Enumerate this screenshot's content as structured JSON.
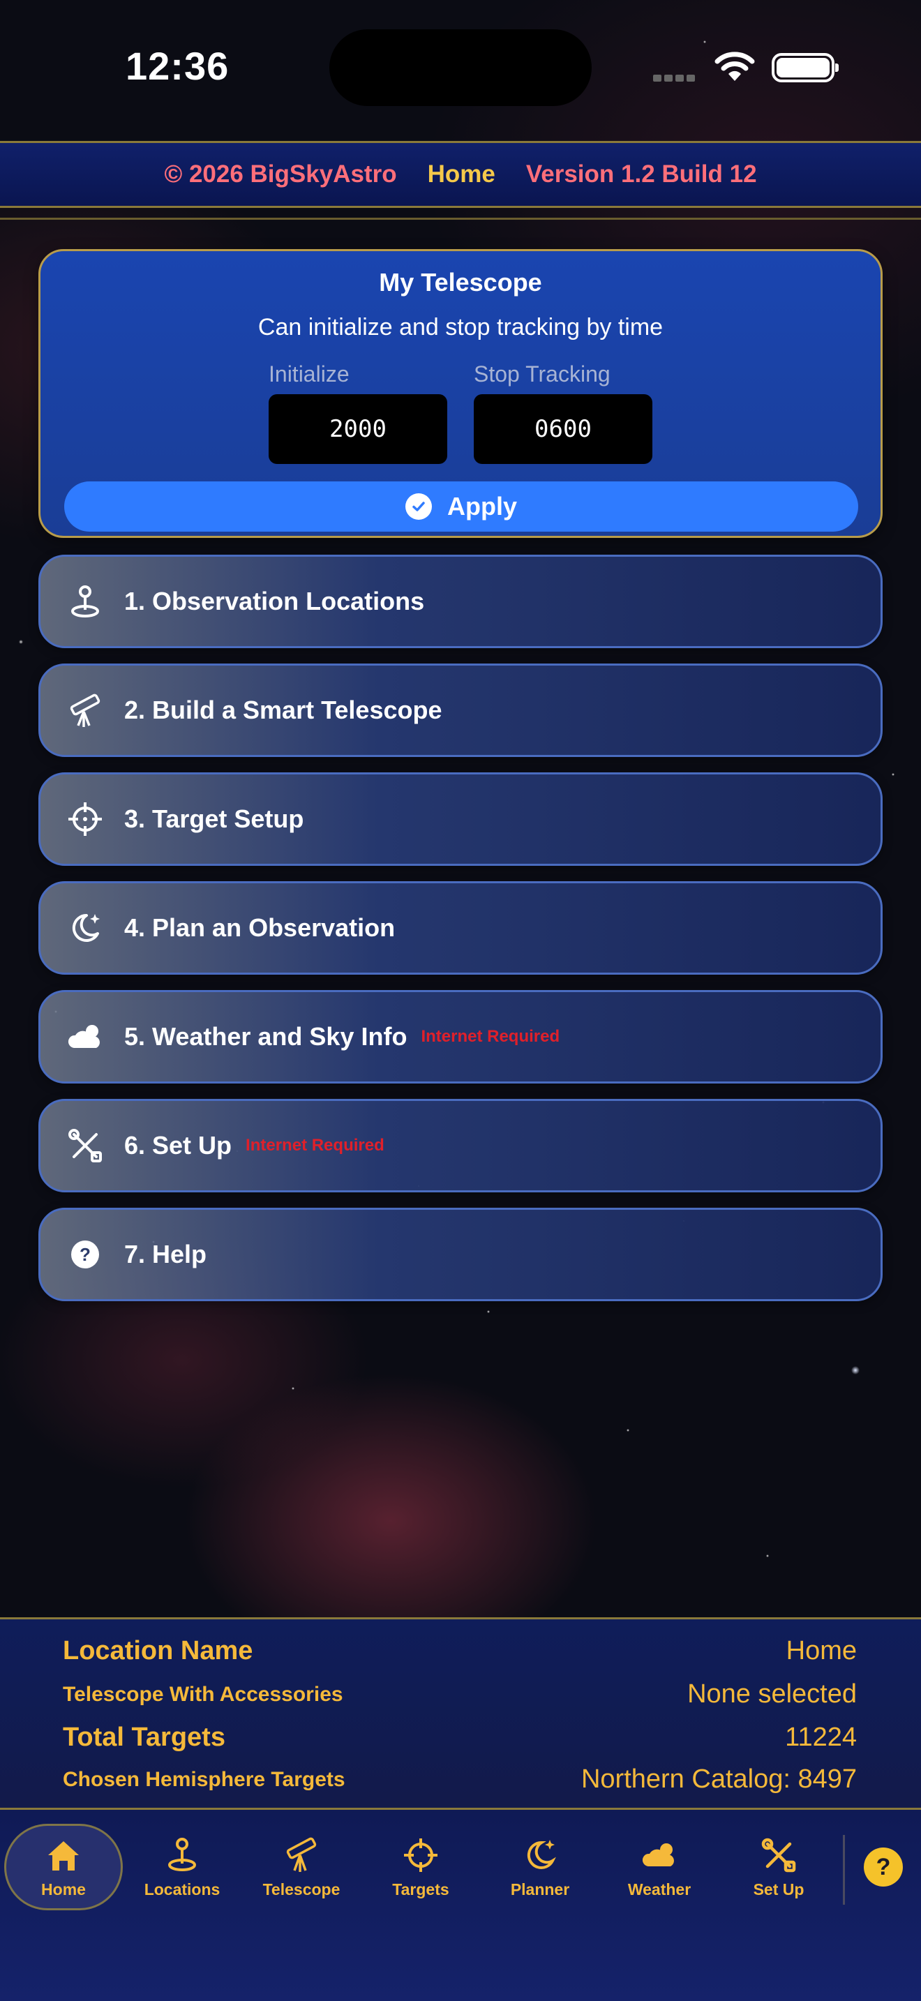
{
  "status": {
    "time": "12:36"
  },
  "header": {
    "copyright": "© 2026 BigSkyAstro",
    "current": "Home",
    "version": "Version 1.2 Build 12"
  },
  "telescope_card": {
    "title": "My Telescope",
    "subtitle": "Can initialize and stop tracking by time",
    "initialize_label": "Initialize",
    "initialize_value": "2000",
    "stop_label": "Stop Tracking",
    "stop_value": "0600",
    "apply_label": "Apply"
  },
  "menu": [
    {
      "label": "1. Observation Locations",
      "note": "",
      "icon": "location-pin-icon"
    },
    {
      "label": "2. Build a Smart Telescope",
      "note": "",
      "icon": "telescope-icon"
    },
    {
      "label": "3. Target Setup",
      "note": "",
      "icon": "crosshair-icon"
    },
    {
      "label": "4. Plan an Observation",
      "note": "",
      "icon": "moon-stars-icon"
    },
    {
      "label": "5. Weather and Sky Info",
      "note": "Internet Required",
      "icon": "cloud-sun-icon"
    },
    {
      "label": "6. Set Up",
      "note": "Internet Required",
      "icon": "tools-icon"
    },
    {
      "label": "7. Help",
      "note": "",
      "icon": "help-icon"
    }
  ],
  "info": {
    "location_label": "Location Name",
    "location_value": "Home",
    "telescope_label": "Telescope With Accessories",
    "telescope_value": "None selected",
    "targets_label": "Total Targets",
    "targets_value": "11224",
    "hemisphere_label": "Chosen Hemisphere Targets",
    "hemisphere_value": "Northern Catalog: 8497"
  },
  "tabs": [
    {
      "label": "Home",
      "icon": "home-icon",
      "active": true
    },
    {
      "label": "Locations",
      "icon": "location-pin-icon",
      "active": false
    },
    {
      "label": "Telescope",
      "icon": "telescope-icon",
      "active": false
    },
    {
      "label": "Targets",
      "icon": "crosshair-icon",
      "active": false
    },
    {
      "label": "Planner",
      "icon": "moon-stars-icon",
      "active": false
    },
    {
      "label": "Weather",
      "icon": "cloud-sun-icon",
      "active": false
    },
    {
      "label": "Set Up",
      "icon": "tools-icon",
      "active": false
    }
  ],
  "help_fab": "?",
  "colors": {
    "accent_gold": "#f5b93a",
    "header_red": "#ff6f7a",
    "apply_blue": "#2f7bff",
    "warning_red": "#e0202a"
  }
}
